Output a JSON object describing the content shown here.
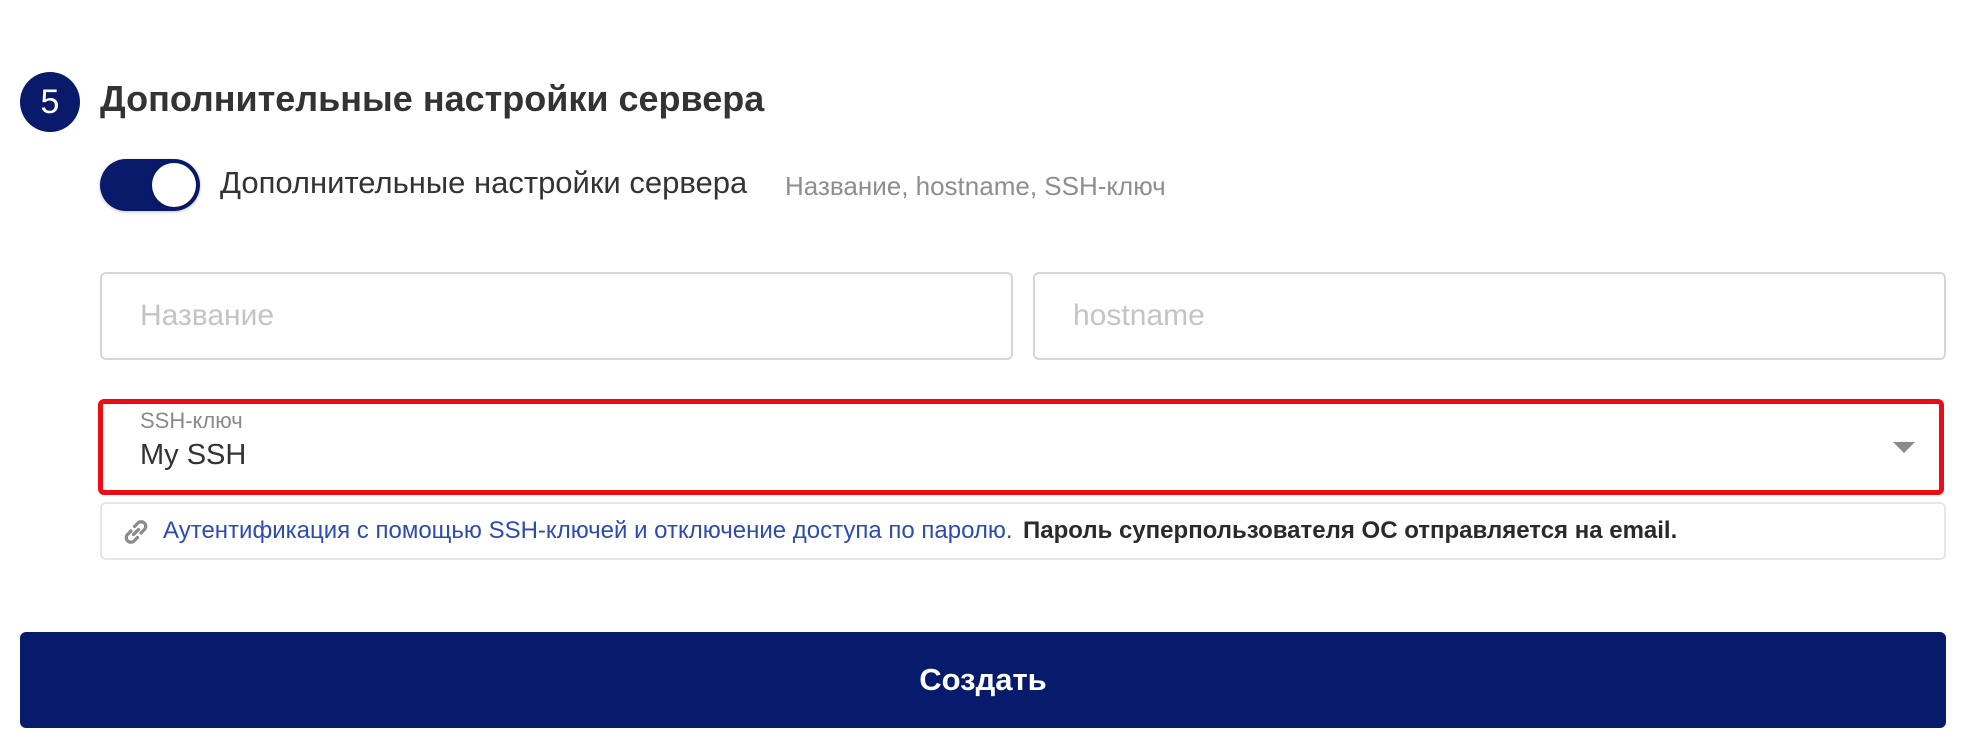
{
  "section": {
    "step_number": "5",
    "title": "Дополнительные настройки сервера"
  },
  "toggle": {
    "label": "Дополнительные настройки сервера",
    "hint": "Название, hostname, SSH-ключ",
    "state": "on"
  },
  "fields": {
    "name": {
      "value": "",
      "placeholder": "Название"
    },
    "hostname": {
      "value": "",
      "placeholder": "hostname"
    }
  },
  "ssh_select": {
    "label": "SSH-ключ",
    "selected": "My SSH"
  },
  "info": {
    "icon": "link-icon",
    "link_text": "Аутентификация с помощью SSH-ключей и отключение доступа по паролю.",
    "note": "Пароль суперпользователя ОС отправляется на email."
  },
  "actions": {
    "create_label": "Создать"
  },
  "colors": {
    "primary": "#061b6c",
    "highlight_border": "#ec0c13",
    "link": "#2d4bb0"
  }
}
